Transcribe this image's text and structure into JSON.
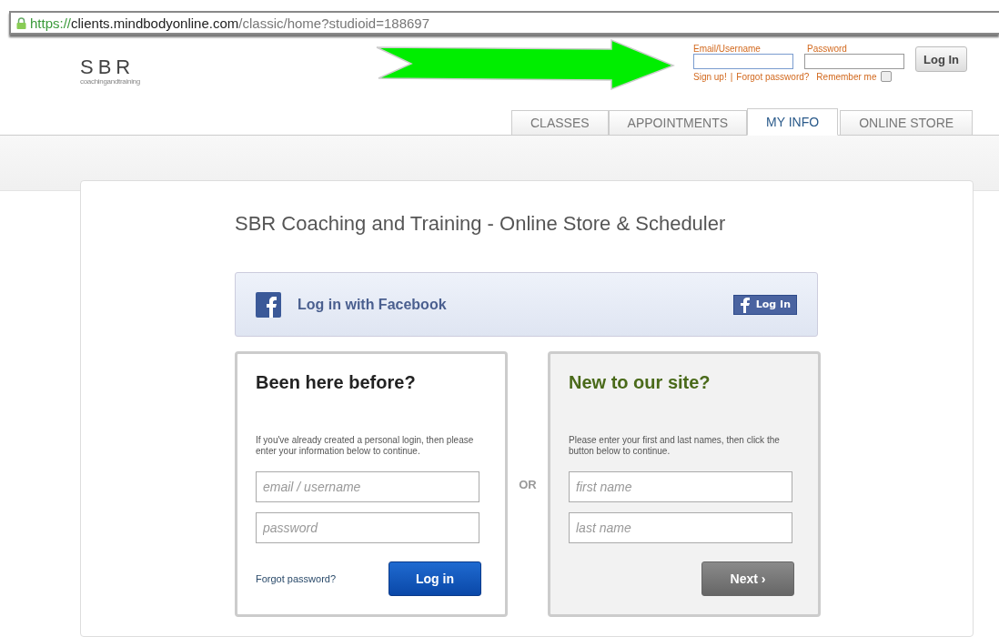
{
  "address_bar": {
    "scheme": "https://",
    "host": "clients.mindbodyonline.com",
    "path": "/classic/home?studioid=188697"
  },
  "logo": {
    "name": "SBR",
    "tagline": "coachingandtraining"
  },
  "header_login": {
    "email_label": "Email/Username",
    "password_label": "Password",
    "button": "Log In",
    "signup": "Sign up!",
    "separator": "|",
    "forgot": "Forgot password?",
    "remember": "Remember me",
    "remember_checked": false
  },
  "tabs": [
    {
      "label": "CLASSES",
      "selected": false
    },
    {
      "label": "APPOINTMENTS",
      "selected": false
    },
    {
      "label": "MY INFO",
      "selected": true
    },
    {
      "label": "ONLINE STORE",
      "selected": false
    }
  ],
  "title": "SBR Coaching and Training - Online Store & Scheduler",
  "facebook": {
    "label": "Log in with Facebook",
    "button": "Log In"
  },
  "returning": {
    "heading": "Been here before?",
    "text": "If you've already created a personal login, then please enter your information below to continue.",
    "fields": [
      {
        "placeholder": "email / username"
      },
      {
        "placeholder": "password"
      }
    ],
    "link": "Forgot password?",
    "button": "Log in"
  },
  "or": "OR",
  "new_user": {
    "heading": "New to our site?",
    "text": "Please enter your first and last names, then click the button below to continue.",
    "fields": [
      {
        "placeholder": "first name"
      },
      {
        "placeholder": "last name"
      }
    ],
    "button": "Next ›"
  }
}
